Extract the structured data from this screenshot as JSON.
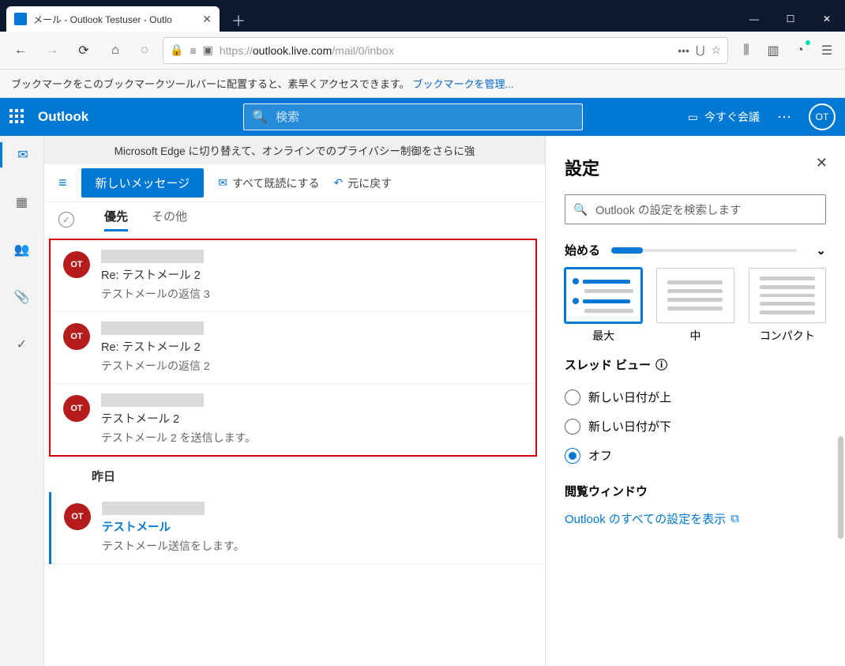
{
  "browser": {
    "tab_title": "メール - Outlook Testuser - Outlo",
    "url_proto": "https://",
    "url_host": "outlook.live.com",
    "url_path": "/mail/0/inbox",
    "bookmark_msg": "ブックマークをこのブックマークツールバーに配置すると、素早くアクセスできます。",
    "bookmark_link": "ブックマークを管理..."
  },
  "suite": {
    "brand": "Outlook",
    "search_placeholder": "検索",
    "meet_now": "今すぐ会議",
    "avatar": "OT"
  },
  "banner": "Microsoft Edge に切り替えて、オンラインでのプライバシー制御をさらに強",
  "commands": {
    "new_message": "新しいメッセージ",
    "mark_all_read": "すべて既読にする",
    "undo": "元に戻す"
  },
  "pivots": {
    "focused": "優先",
    "other": "その他"
  },
  "messages_highlighted": [
    {
      "avatar": "OT",
      "subject": "Re: テストメール 2",
      "preview": "テストメールの返信 3",
      "unread": false
    },
    {
      "avatar": "OT",
      "subject": "Re: テストメール 2",
      "preview": "テストメールの返信 2",
      "unread": false
    },
    {
      "avatar": "OT",
      "subject": "テストメール 2",
      "preview": "テストメール 2 を送信します。",
      "unread": false
    }
  ],
  "day_header": "昨日",
  "messages_rest": [
    {
      "avatar": "OT",
      "subject": "テストメール",
      "preview": "テストメール送信をします。",
      "unread": true
    }
  ],
  "settings": {
    "title": "設定",
    "search_placeholder": "Outlook の設定を検索します",
    "getting_started": "始める",
    "density": {
      "large": "最大",
      "medium": "中",
      "compact": "コンパクト"
    },
    "thread_view": "スレッド ビュー",
    "thread_opts": {
      "newest_top": "新しい日付が上",
      "newest_bottom": "新しい日付が下",
      "off": "オフ"
    },
    "reading_pane": "閲覧ウィンドウ",
    "all_settings": "Outlook のすべての設定を表示"
  }
}
